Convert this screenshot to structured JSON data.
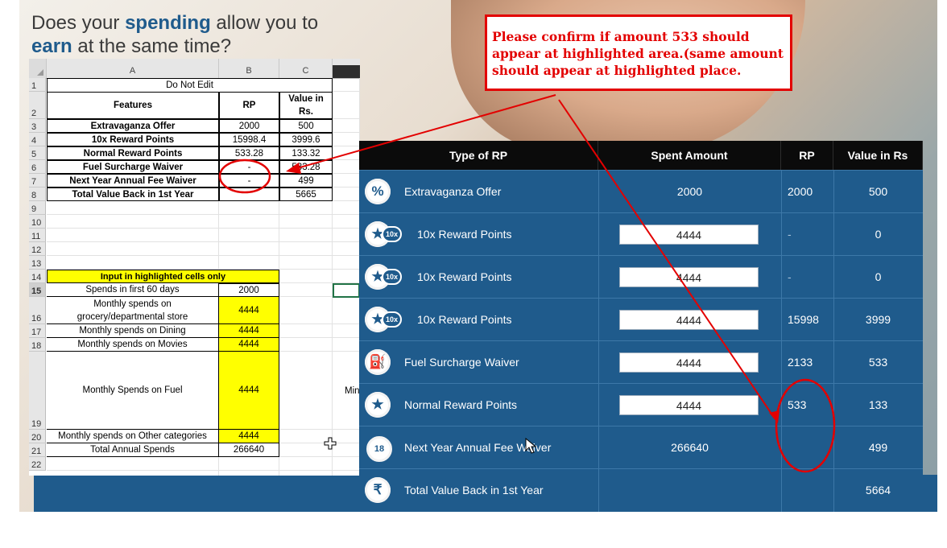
{
  "headline": {
    "part1": "Does your ",
    "spending": "spending",
    "part2": " allow you to",
    "earn": "earn",
    "part3": " at the same time?"
  },
  "excel": {
    "columns": [
      "A",
      "B",
      "C"
    ],
    "row_numbers": [
      "1",
      "2",
      "3",
      "4",
      "5",
      "6",
      "7",
      "8",
      "9",
      "10",
      "11",
      "12",
      "13",
      "14",
      "15",
      "16",
      "17",
      "18",
      "19",
      "20",
      "21",
      "22"
    ],
    "title": "Do Not Edit",
    "header": {
      "features": "Features",
      "rp": "RP",
      "value_line1": "Value in",
      "value_line2": "Rs."
    },
    "summary_rows": [
      {
        "feature": "Extravaganza Offer",
        "rp": "2000",
        "value": "500"
      },
      {
        "feature": "10x Reward Points",
        "rp": "15998.4",
        "value": "3999.6"
      },
      {
        "feature": "Normal Reward Points",
        "rp": "533.28",
        "value": "133.32"
      },
      {
        "feature": "Fuel Surcharge Waiver",
        "rp": "-",
        "value": "533.28"
      },
      {
        "feature": "Next Year Annual Fee Waiver",
        "rp": "-",
        "value": "499"
      },
      {
        "feature": "Total Value Back in 1st Year",
        "rp": "",
        "value": "5665"
      }
    ],
    "input_header": "Input in highlighted cells only",
    "input_rows": [
      {
        "label": "Spends in first 60 days",
        "value": "2000"
      },
      {
        "label_line1": "Monthly spends on",
        "label_line2": "grocery/departmental store",
        "value": "4444"
      },
      {
        "label": "Monthly spends on Dining",
        "value": "4444"
      },
      {
        "label": "Monthly spends on Movies",
        "value": "4444"
      },
      {
        "label": "Monthly Spends on Fuel",
        "value": "4444"
      },
      {
        "label": "Monthly spends on Other categories",
        "value": "4444"
      },
      {
        "label": "Total Annual Spends",
        "value": "266640"
      }
    ],
    "clipped_text": "Min"
  },
  "dashboard": {
    "headers": [
      "Type of RP",
      "Spent Amount",
      "RP",
      "Value in Rs"
    ],
    "rows": [
      {
        "icon": "percent-icon",
        "glyph": "%",
        "label": "Extravaganza Offer",
        "spent": "2000",
        "rp": "2000",
        "value": "500",
        "input": false
      },
      {
        "icon": "star-10x-icon",
        "glyph": "★",
        "badge": "10x",
        "label": "10x Reward Points",
        "spent": "4444",
        "rp": "-",
        "value": "0",
        "input": true
      },
      {
        "icon": "star-10x-icon",
        "glyph": "★",
        "badge": "10x",
        "label": "10x Reward Points",
        "spent": "4444",
        "rp": "-",
        "value": "0",
        "input": true
      },
      {
        "icon": "star-10x-icon",
        "glyph": "★",
        "badge": "10x",
        "label": "10x Reward Points",
        "spent": "4444",
        "rp": "15998",
        "value": "3999",
        "input": true
      },
      {
        "icon": "fuel-pump-icon",
        "glyph": "⛽",
        "label": "Fuel Surcharge Waiver",
        "spent": "4444",
        "rp": "2133",
        "value": "533",
        "input": true
      },
      {
        "icon": "star-icon",
        "glyph": "★",
        "label": "Normal Reward Points",
        "spent": "4444",
        "rp": "533",
        "value": "133",
        "input": true
      },
      {
        "icon": "calendar-icon",
        "glyph": "18",
        "label": "Next Year Annual Fee Waiver",
        "spent": "266640",
        "rp": "",
        "value": "499",
        "input": false
      },
      {
        "icon": "rupee-icon",
        "glyph": "₹",
        "label": "Total Value Back in 1st Year",
        "spent": "",
        "rp": "",
        "value": "5664",
        "input": false
      }
    ]
  },
  "annotation": {
    "line1": "Please confirm if amount 533 should",
    "line2": "appear at highlighted area.(same amount",
    "line3": "should appear at highlighted place."
  },
  "colors": {
    "brand_blue": "#1f5b8c",
    "annotation_red": "#e30000",
    "header_black": "#0b0b0b",
    "excel_yellow": "#ffff00"
  }
}
